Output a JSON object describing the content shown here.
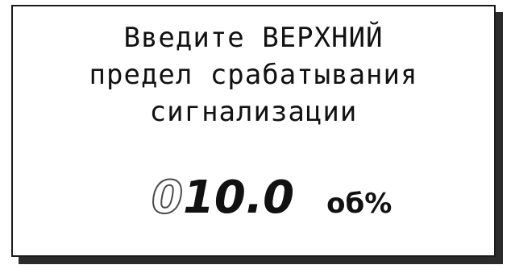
{
  "prompt": {
    "line1": "Введите ВЕРХНИЙ",
    "line2": "предел срабатывания",
    "line3": "сигнализации"
  },
  "value": {
    "cursor_digit": "0",
    "digits": "10.0",
    "unit": "об%"
  }
}
